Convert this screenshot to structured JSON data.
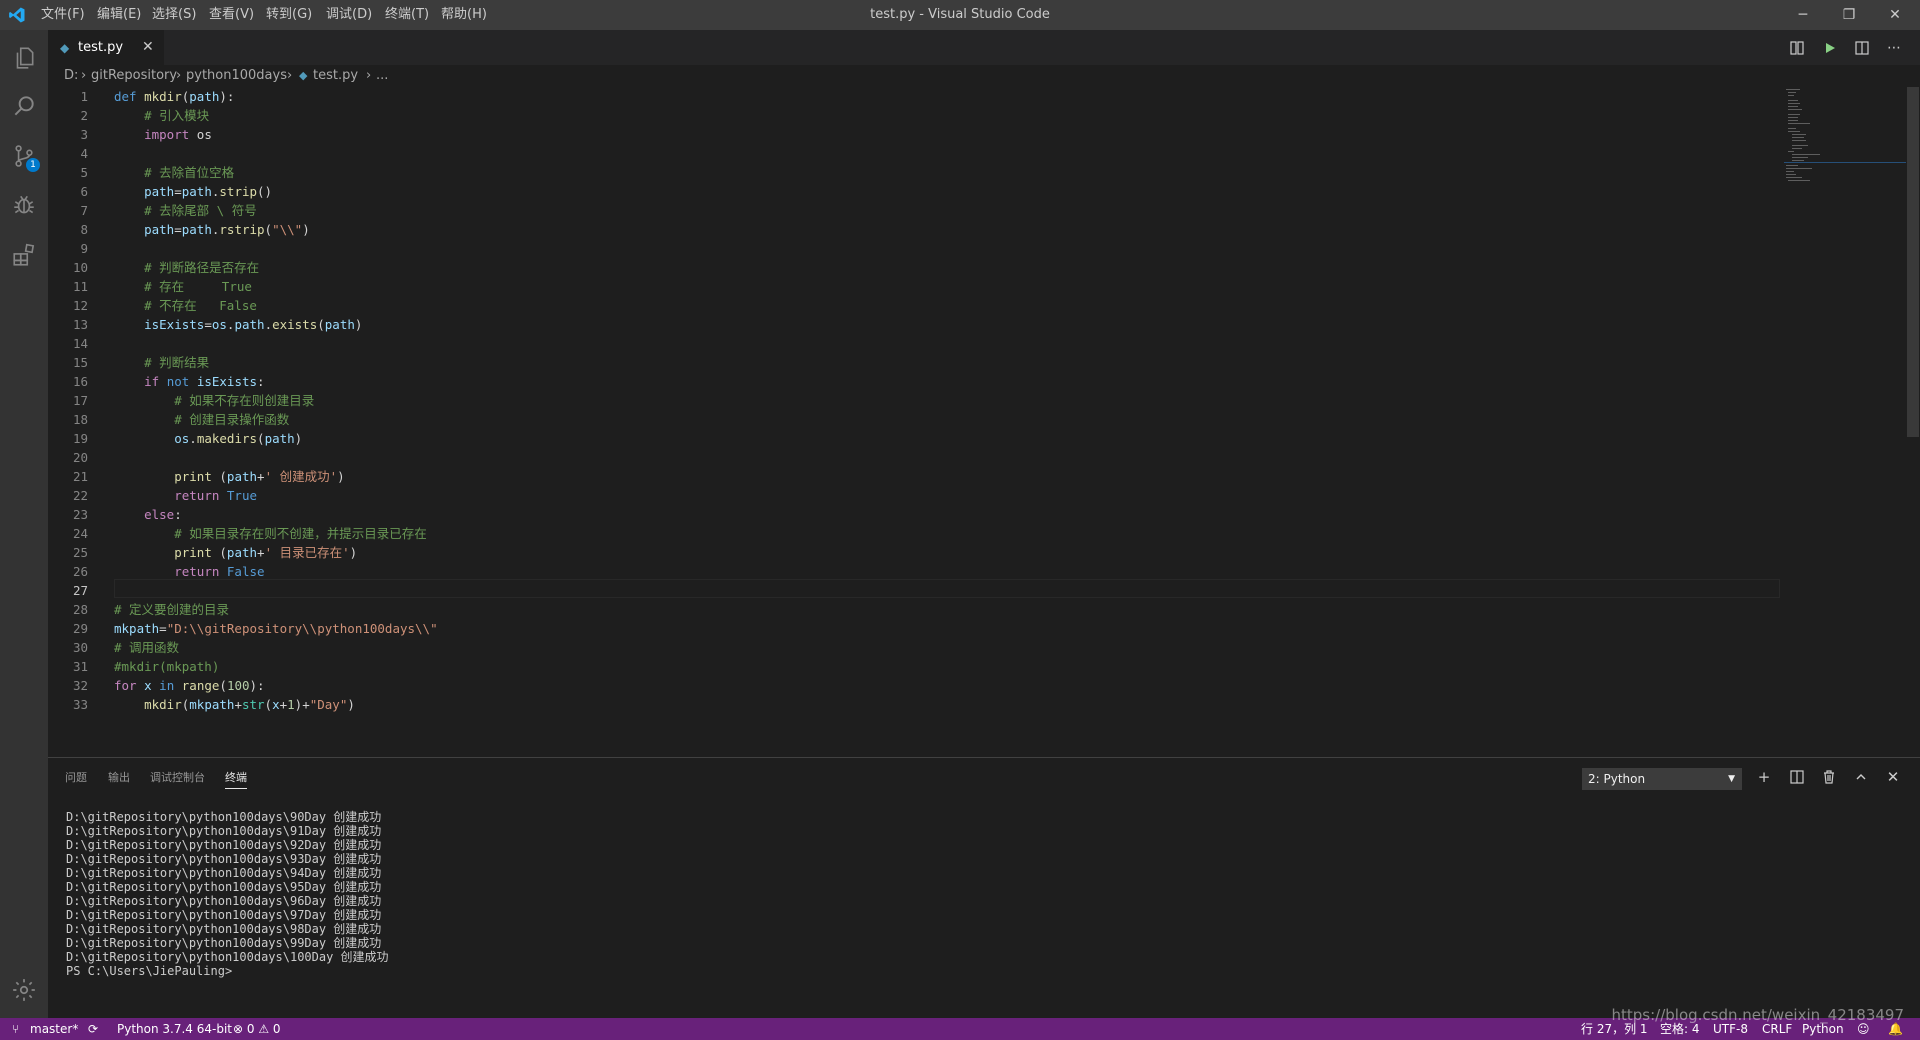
{
  "window": {
    "title": "test.py - Visual Studio Code",
    "menu": [
      "文件(F)",
      "编辑(E)",
      "选择(S)",
      "查看(V)",
      "转到(G)",
      "调试(D)",
      "终端(T)",
      "帮助(H)"
    ],
    "controls": {
      "minimize": "─",
      "restore": "❐",
      "close": "✕"
    }
  },
  "activity_bar": {
    "items": [
      "explorer-icon",
      "search-icon",
      "source-control-icon",
      "debug-icon",
      "extensions-icon"
    ],
    "source_control_badge": "1",
    "bottom": "gear-icon"
  },
  "tab": {
    "filename": "test.py",
    "close": "✕",
    "file_icon": "◆"
  },
  "breadcrumb": [
    "D:",
    "gitRepository",
    "python100days",
    "test.py",
    "..."
  ],
  "editor": {
    "current_line": 27,
    "lines": [
      {
        "n": "1"
      },
      {
        "n": "2"
      },
      {
        "n": "3"
      },
      {
        "n": "4"
      },
      {
        "n": "5"
      },
      {
        "n": "6"
      },
      {
        "n": "7"
      },
      {
        "n": "8"
      },
      {
        "n": "9"
      },
      {
        "n": "10"
      },
      {
        "n": "11"
      },
      {
        "n": "12"
      },
      {
        "n": "13"
      },
      {
        "n": "14"
      },
      {
        "n": "15"
      },
      {
        "n": "16"
      },
      {
        "n": "17"
      },
      {
        "n": "18"
      },
      {
        "n": "19"
      },
      {
        "n": "20"
      },
      {
        "n": "21"
      },
      {
        "n": "22"
      },
      {
        "n": "23"
      },
      {
        "n": "24"
      },
      {
        "n": "25"
      },
      {
        "n": "26"
      },
      {
        "n": "27"
      },
      {
        "n": "28"
      },
      {
        "n": "29"
      },
      {
        "n": "30"
      },
      {
        "n": "31"
      },
      {
        "n": "32"
      },
      {
        "n": "33"
      }
    ],
    "code": {
      "l1": {
        "def": "def",
        "name": "mkdir",
        "open": "(",
        "param": "path",
        "close": "):"
      },
      "l2": "# 引入模块",
      "l3": {
        "kw": "import",
        "mod": " os"
      },
      "l5": "# 去除首位空格",
      "l6": {
        "a": "path",
        "b": "=",
        "c": "path",
        "d": ".",
        "e": "strip",
        "f": "()"
      },
      "l7": "# 去除尾部 \\ 符号",
      "l8": {
        "a": "path",
        "b": "=",
        "c": "path",
        "d": ".",
        "e": "rstrip",
        "f": "(",
        "g": "\"\\\\\"",
        "h": ")"
      },
      "l10": "# 判断路径是否存在",
      "l11": "# 存在     True",
      "l12": "# 不存在   False",
      "l13": {
        "a": "isExists",
        "b": "=",
        "c": "os",
        "d": ".",
        "e": "path",
        "f": ".",
        "g": "exists",
        "h": "(",
        "i": "path",
        "j": ")"
      },
      "l15": "# 判断结果",
      "l16": {
        "a": "if",
        "b": " ",
        "c": "not",
        "d": " ",
        "e": "isExists",
        "f": ":"
      },
      "l17": "# 如果不存在则创建目录",
      "l18": "# 创建目录操作函数",
      "l19": {
        "a": "os",
        "b": ".",
        "c": "makedirs",
        "d": "(",
        "e": "path",
        "f": ")"
      },
      "l21": {
        "a": "print",
        "b": " (",
        "c": "path",
        "d": "+",
        "e": "' 创建成功'",
        "f": ")"
      },
      "l22": {
        "a": "return",
        "b": " ",
        "c": "True"
      },
      "l23": {
        "a": "else",
        "b": ":"
      },
      "l24": "# 如果目录存在则不创建，并提示目录已存在",
      "l25": {
        "a": "print",
        "b": " (",
        "c": "path",
        "d": "+",
        "e": "' 目录已存在'",
        "f": ")"
      },
      "l26": {
        "a": "return",
        "b": " ",
        "c": "False"
      },
      "l28": "# 定义要创建的目录",
      "l29": {
        "a": "mkpath",
        "b": "=",
        "c": "\"D:\\\\gitRepository\\\\python100days\\\\\""
      },
      "l30": "# 调用函数",
      "l31": "#mkdir(mkpath)",
      "l32": {
        "a": "for",
        "b": " ",
        "c": "x",
        "d": " ",
        "e": "in",
        "f": " ",
        "g": "range",
        "h": "(",
        "i": "100",
        "j": "):"
      },
      "l33": {
        "a": "mkdir",
        "b": "(",
        "c": "mkpath",
        "d": "+",
        "e": "str",
        "f": "(",
        "g": "x",
        "h": "+",
        "i": "1",
        "j": ")+",
        "k": "\"Day\"",
        "l": ")"
      }
    }
  },
  "panel": {
    "tabs": [
      "问题",
      "输出",
      "调试控制台",
      "终端"
    ],
    "active_tab": "终端",
    "terminal_select": "2: Python",
    "buttons": {
      "add": "+",
      "split": "◫",
      "trash": "🗑",
      "maximize": "^",
      "close": "✕"
    },
    "terminal_lines": [
      "D:\\gitRepository\\python100days\\90Day 创建成功",
      "D:\\gitRepository\\python100days\\91Day 创建成功",
      "D:\\gitRepository\\python100days\\92Day 创建成功",
      "D:\\gitRepository\\python100days\\93Day 创建成功",
      "D:\\gitRepository\\python100days\\94Day 创建成功",
      "D:\\gitRepository\\python100days\\95Day 创建成功",
      "D:\\gitRepository\\python100days\\96Day 创建成功",
      "D:\\gitRepository\\python100days\\97Day 创建成功",
      "D:\\gitRepository\\python100days\\98Day 创建成功",
      "D:\\gitRepository\\python100days\\99Day 创建成功",
      "D:\\gitRepository\\python100days\\100Day 创建成功",
      "PS C:\\Users\\JiePauling>"
    ]
  },
  "status_bar": {
    "branch": "master*",
    "sync": "⟳",
    "interpreter": "Python 3.7.4 64-bit",
    "problems": "⊗ 0 ⚠ 0",
    "position": "行 27，列 1",
    "spaces": "空格: 4",
    "encoding": "UTF-8",
    "eol": "CRLF",
    "language": "Python",
    "feedback": "☺",
    "bell": "🔔"
  },
  "watermark": "https://blog.csdn.net/weixin_42183497",
  "colors": {
    "statusbar": "#68217a",
    "accent": "#007acc",
    "keyword": "#569cd6",
    "string": "#ce9178",
    "comment": "#6a9955"
  }
}
